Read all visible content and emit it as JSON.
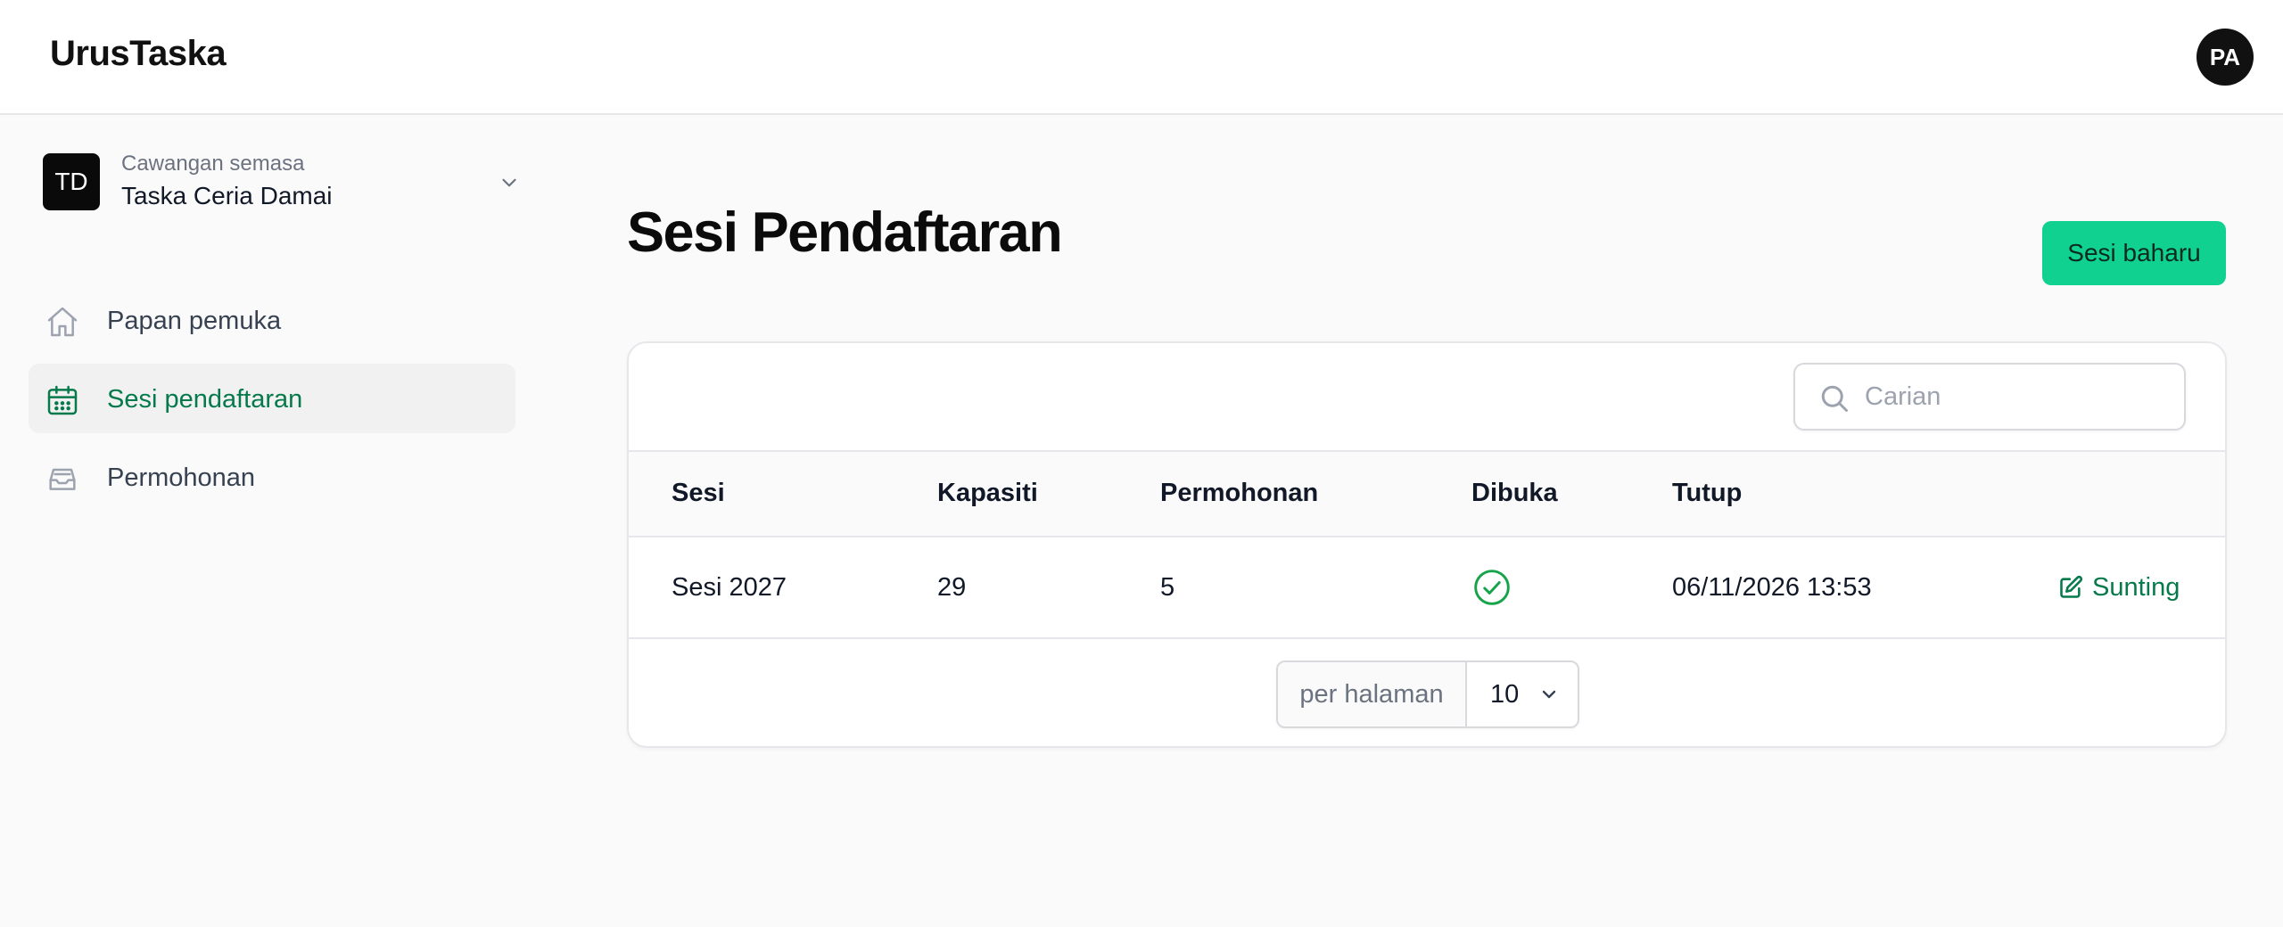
{
  "app": {
    "brand": "UrusTaska",
    "user_initials": "PA"
  },
  "sidebar": {
    "branch": {
      "initials": "TD",
      "caption": "Cawangan semasa",
      "name": "Taska Ceria Damai"
    },
    "items": [
      {
        "label": "Papan pemuka",
        "icon": "home-icon",
        "active": false
      },
      {
        "label": "Sesi pendaftaran",
        "icon": "calendar-icon",
        "active": true
      },
      {
        "label": "Permohonan",
        "icon": "inbox-icon",
        "active": false
      }
    ]
  },
  "main": {
    "title": "Sesi Pendaftaran",
    "new_button": "Sesi baharu",
    "search": {
      "placeholder": "Carian",
      "value": ""
    },
    "table": {
      "columns": [
        "Sesi",
        "Kapasiti",
        "Permohonan",
        "Dibuka",
        "Tutup"
      ],
      "rows": [
        {
          "sesi": "Sesi 2027",
          "kapasiti": "29",
          "permohonan": "5",
          "dibuka": true,
          "tutup": "06/11/2026 13:53",
          "action": "Sunting"
        }
      ]
    },
    "pagination": {
      "label": "per halaman",
      "per_page": "10"
    }
  },
  "colors": {
    "accent_green": "#10d190",
    "link_green": "#067a4b",
    "check_green": "#16a34a"
  }
}
